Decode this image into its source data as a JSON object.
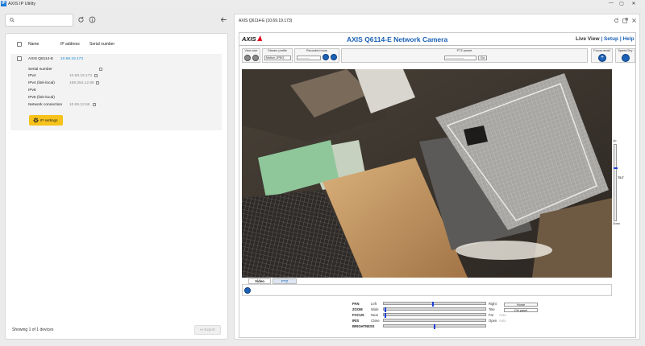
{
  "app": {
    "title": "AXIS IP Utility",
    "logo_letter": "IP"
  },
  "window_controls": {
    "minimize": "—",
    "maximize": "▢",
    "close": "✕"
  },
  "left": {
    "search_placeholder": "",
    "columns": {
      "name": "Name",
      "ip": "IP address",
      "serial": "Serial number"
    },
    "device": {
      "name": "AXIS Q6114-E",
      "ip": "10.69.19.173",
      "serial": "",
      "details": [
        {
          "label": "Serial number",
          "value": ""
        },
        {
          "label": "IPv4",
          "value": "10.69.19.173"
        },
        {
          "label": "IPv4 (link-local)",
          "value": "169.254.12.86"
        },
        {
          "label": "IPv6",
          "value": ""
        },
        {
          "label": "IPv6 (link-local)",
          "value": ""
        },
        {
          "label": "Network connection",
          "value": "10.69.12.86"
        }
      ],
      "ip_settings_label": "IP settings"
    },
    "footer": "Showing 1 of 1 devices",
    "export_label": "Export"
  },
  "right": {
    "title": "AXIS Q6114-E (10.69.19.173)",
    "camera": {
      "logo": "AXIS",
      "title": "AXIS Q6114-E Network Camera",
      "nav": {
        "live": "Live View",
        "sep1": " | ",
        "setup": "Setup",
        "sep2": " | ",
        "help": "Help"
      },
      "toolbar": {
        "view_size": "View size",
        "stream_profile": "Stream profile",
        "stream_value": "Motion JPEG",
        "recorded_tours": "Recorded tours",
        "tours_value": "-----------",
        "ptz_preset": "PTZ preset",
        "preset_value": "------------------",
        "go": "Go",
        "focus_recall": "Focus recall",
        "speed_dry": "Speed Dry"
      },
      "zoom_slider": {
        "top": "Up",
        "mid": "TILT",
        "bottom": "Down"
      },
      "tabs": {
        "video": "Video",
        "ptz": "PTZ"
      },
      "controls": [
        {
          "name": "PAN",
          "left": "Left",
          "right": "Right",
          "level": 0.48
        },
        {
          "name": "ZOOM",
          "left": "Wide",
          "right": "Tele",
          "level": 0.01
        },
        {
          "name": "FOCUS",
          "left": "Near",
          "right": "Far",
          "extra": "Auto",
          "level": 0.01
        },
        {
          "name": "IRIS",
          "left": "Close",
          "right": "Open",
          "extra": "Auto",
          "level": null
        },
        {
          "name": "BRIGHTNESS",
          "left": "",
          "right": "",
          "level": 0.5
        }
      ],
      "home_label": "Home",
      "ctrl_panel_label": "Ctrl panel"
    }
  }
}
